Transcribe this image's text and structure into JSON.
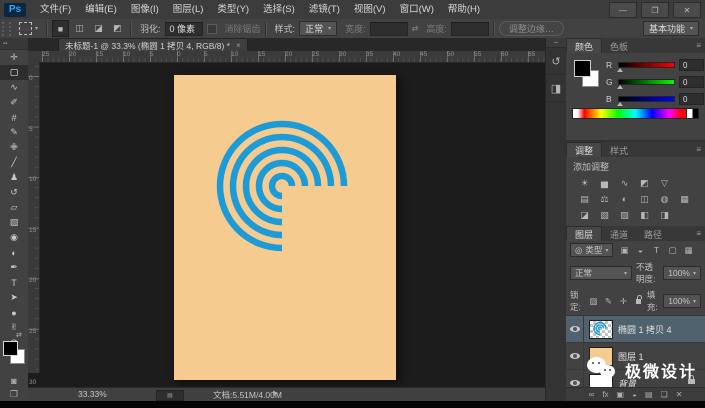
{
  "window": {
    "minimize": "—",
    "maximize": "❐",
    "close": "✕"
  },
  "menu": {
    "logo": "Ps",
    "items": [
      "文件(F)",
      "编辑(E)",
      "图像(I)",
      "图层(L)",
      "类型(Y)",
      "选择(S)",
      "滤镜(T)",
      "视图(V)",
      "窗口(W)",
      "帮助(H)"
    ]
  },
  "options": {
    "mode_icons": [
      {
        "name": "new-selection-icon",
        "glyph": "■",
        "active": true
      },
      {
        "name": "add-to-selection-icon",
        "glyph": "◫",
        "active": false
      },
      {
        "name": "subtract-from-selection-icon",
        "glyph": "◪",
        "active": false
      },
      {
        "name": "intersect-selection-icon",
        "glyph": "◩",
        "active": false
      }
    ],
    "feather_label": "羽化:",
    "feather_value": "0 像素",
    "antialias_label": "消除锯齿",
    "style_label": "样式:",
    "style_value": "正常",
    "width_label": "宽度:",
    "width_value": "",
    "swap_icon": "⇄",
    "height_label": "高度:",
    "height_value": "",
    "refine_edge_label": "调整边缘…",
    "workspace_label": "基本功能",
    "caret": "▾"
  },
  "document_tab": {
    "title": "未标题-1 @ 33.3% (椭圆 1 拷贝 4, RGB/8) *",
    "close_icon": "×"
  },
  "rulers": {
    "horizontal": [
      "25",
      "20",
      "15",
      "10",
      "5",
      "0",
      "5",
      "10",
      "15",
      "20",
      "25",
      "30",
      "35",
      "40",
      "45",
      "50",
      "55",
      "60",
      "65"
    ],
    "vertical": [
      "0",
      "5",
      "10",
      "15",
      "20",
      "25",
      "30"
    ]
  },
  "tools": [
    {
      "name": "move-tool",
      "glyph": "✛",
      "active": false
    },
    {
      "name": "rectangular-marquee-tool",
      "glyph": "▢",
      "active": true
    },
    {
      "name": "lasso-tool",
      "glyph": "∿",
      "active": false
    },
    {
      "name": "quick-selection-tool",
      "glyph": "✐",
      "active": false
    },
    {
      "name": "crop-tool",
      "glyph": "#",
      "active": false
    },
    {
      "name": "eyedropper-tool",
      "glyph": "✎",
      "active": false
    },
    {
      "name": "spot-healing-tool",
      "glyph": "✙",
      "active": false
    },
    {
      "name": "brush-tool",
      "glyph": "╱",
      "active": false
    },
    {
      "name": "clone-stamp-tool",
      "glyph": "♟",
      "active": false
    },
    {
      "name": "history-brush-tool",
      "glyph": "↺",
      "active": false
    },
    {
      "name": "eraser-tool",
      "glyph": "▱",
      "active": false
    },
    {
      "name": "gradient-tool",
      "glyph": "▧",
      "active": false
    },
    {
      "name": "blur-tool",
      "glyph": "◉",
      "active": false
    },
    {
      "name": "dodge-tool",
      "glyph": "◐",
      "active": false
    },
    {
      "name": "pen-tool",
      "glyph": "✒",
      "active": false
    },
    {
      "name": "type-tool",
      "glyph": "T",
      "active": false
    },
    {
      "name": "path-selection-tool",
      "glyph": "➤",
      "active": false
    },
    {
      "name": "ellipse-shape-tool",
      "glyph": "●",
      "active": false
    },
    {
      "name": "hand-tool",
      "glyph": "✌",
      "active": false
    },
    {
      "name": "zoom-tool",
      "glyph": "Q",
      "active": false
    }
  ],
  "toolbar_extras": {
    "collapse_icon": "▪▪",
    "swap_colors_icon": "⇄",
    "quick_mask_icon": "◙",
    "screen_mode_icon": "❐"
  },
  "dock": {
    "icons": [
      {
        "name": "history-panel-icon",
        "glyph": "↺"
      },
      {
        "name": "properties-panel-icon",
        "glyph": "◨"
      }
    ]
  },
  "color_panel": {
    "tabs": [
      {
        "label": "颜色",
        "active": true
      },
      {
        "label": "色板",
        "active": false
      }
    ],
    "menu_icon": "≡",
    "channels": [
      {
        "label": "R",
        "value": "0",
        "track": "linear-gradient(to right,#000,#f00)"
      },
      {
        "label": "G",
        "value": "0",
        "track": "linear-gradient(to right,#000,#0f0)"
      },
      {
        "label": "B",
        "value": "0",
        "track": "linear-gradient(to right,#000,#00f)"
      }
    ]
  },
  "adjustments_panel": {
    "tabs": [
      {
        "label": "调整",
        "active": true
      },
      {
        "label": "样式",
        "active": false
      }
    ],
    "menu_icon": "≡",
    "header": "添加调整",
    "rows": [
      [
        {
          "name": "brightness-contrast-icon",
          "glyph": "☀"
        },
        {
          "name": "levels-icon",
          "glyph": "▅"
        },
        {
          "name": "curves-icon",
          "glyph": "∿"
        },
        {
          "name": "exposure-icon",
          "glyph": "◩"
        },
        {
          "name": "vibrance-icon",
          "glyph": "▽"
        }
      ],
      [
        {
          "name": "hue-saturation-icon",
          "glyph": "▤"
        },
        {
          "name": "color-balance-icon",
          "glyph": "⚖"
        },
        {
          "name": "black-white-icon",
          "glyph": "◐"
        },
        {
          "name": "photo-filter-icon",
          "glyph": "◫"
        },
        {
          "name": "channel-mixer-icon",
          "glyph": "◍"
        },
        {
          "name": "color-lookup-icon",
          "glyph": "▦"
        }
      ],
      [
        {
          "name": "invert-icon",
          "glyph": "◪"
        },
        {
          "name": "posterize-icon",
          "glyph": "▧"
        },
        {
          "name": "threshold-icon",
          "glyph": "▨"
        },
        {
          "name": "gradient-map-icon",
          "glyph": "◧"
        },
        {
          "name": "selective-color-icon",
          "glyph": "◨"
        }
      ]
    ]
  },
  "layers_panel": {
    "tabs": [
      {
        "label": "图层",
        "active": true
      },
      {
        "label": "通道",
        "active": false
      },
      {
        "label": "路径",
        "active": false
      }
    ],
    "menu_icon": "≡",
    "filter": {
      "search_icon": "◎",
      "kind_label": "类型",
      "caret": "▾",
      "icons": [
        {
          "name": "filter-pixel-layers-icon",
          "glyph": "▣"
        },
        {
          "name": "filter-adjustment-layers-icon",
          "glyph": "◒"
        },
        {
          "name": "filter-type-layers-icon",
          "glyph": "T"
        },
        {
          "name": "filter-shape-layers-icon",
          "glyph": "▢"
        },
        {
          "name": "filter-smart-objects-icon",
          "glyph": "▦"
        }
      ]
    },
    "blend_mode": "正常",
    "opacity_label": "不透明度:",
    "opacity_value": "100%",
    "lock_label": "锁定:",
    "lock_icons": [
      {
        "name": "lock-transparency-icon",
        "glyph": "▨"
      },
      {
        "name": "lock-pixels-icon",
        "glyph": "✎"
      },
      {
        "name": "lock-position-icon",
        "glyph": "✛"
      }
    ],
    "fill_label": "填充:",
    "fill_value": "100%",
    "caret": "▾",
    "layers": [
      {
        "name": "椭圆 1 拷贝 4",
        "thumb": "logo",
        "selected": true,
        "locked": false,
        "italic": false
      },
      {
        "name": "图层 1",
        "thumb": "peach",
        "selected": false,
        "locked": false,
        "italic": false
      },
      {
        "name": "背景",
        "thumb": "white",
        "selected": false,
        "locked": true,
        "italic": true
      }
    ],
    "footer_icons": [
      {
        "name": "link-layers-icon",
        "glyph": "∞"
      },
      {
        "name": "layer-effects-icon",
        "glyph": "fx"
      },
      {
        "name": "add-layer-mask-icon",
        "glyph": "▣"
      },
      {
        "name": "new-adjustment-layer-icon",
        "glyph": "◒"
      },
      {
        "name": "new-group-icon",
        "glyph": "▤"
      },
      {
        "name": "new-layer-icon",
        "glyph": "❏"
      },
      {
        "name": "delete-layer-icon",
        "glyph": "✕"
      }
    ]
  },
  "status_bar": {
    "zoom": "33.33%",
    "doc_icon": "▤",
    "doc_info": "文档:5.51M/4.00M",
    "flyout_icon": "▶"
  },
  "watermark": {
    "text": "极微设计"
  },
  "canvas": {
    "bg": "#f6cb8f",
    "ring_color": "#1b9bd8"
  }
}
